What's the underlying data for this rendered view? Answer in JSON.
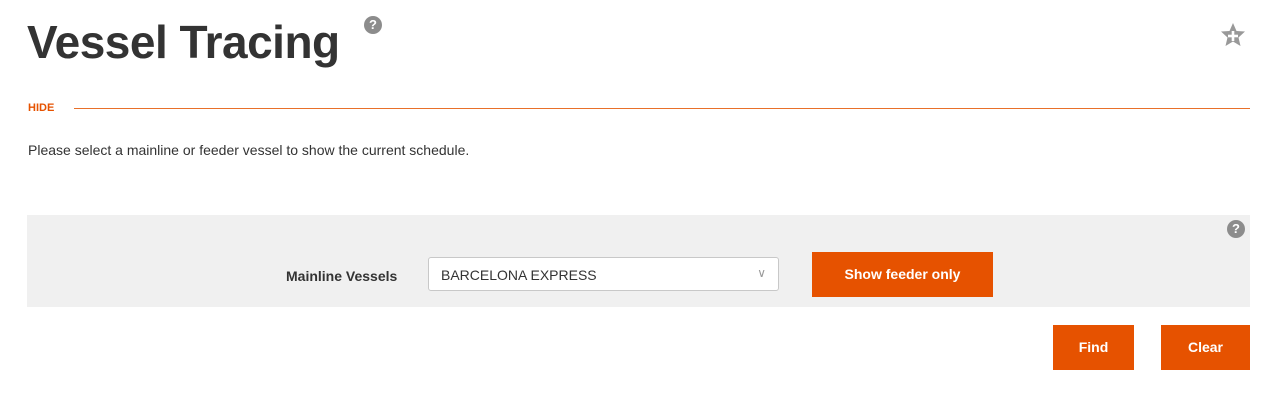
{
  "header": {
    "title": "Vessel Tracing",
    "help_icon": "question-icon",
    "favorite_icon": "star-plus-icon"
  },
  "section": {
    "toggle_label": "HIDE",
    "instruction": "Please select a mainline or feeder vessel to show the current schedule."
  },
  "filter": {
    "help_icon": "question-icon",
    "vessel_label": "Mainline Vessels",
    "vessel_selected": "BARCELONA EXPRESS",
    "chevron_icon": "chevron-down-icon",
    "feeder_button": "Show feeder only"
  },
  "actions": {
    "find_label": "Find",
    "clear_label": "Clear"
  },
  "colors": {
    "accent": "#e65200",
    "panel_bg": "#f0f0f0",
    "text": "#333333"
  }
}
